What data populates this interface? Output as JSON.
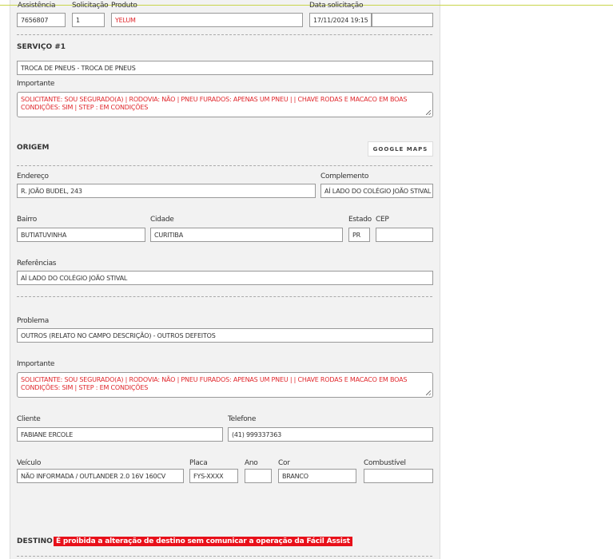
{
  "header": {
    "assistencia_label": "Assistência",
    "assistencia": "7656807",
    "solicitacao_label": "Solicitação",
    "solicitacao": "1",
    "produto_label": "Produto",
    "produto": "YELUM",
    "data_label": "Data solicitação",
    "data": "17/11/2024 19:15",
    "data_extra": ""
  },
  "servico": {
    "title": "SERVIÇO #1",
    "tipo": "TROCA DE PNEUS - TROCA DE PNEUS",
    "importante_label": "Importante",
    "importante": "SOLICITANTE: SOU SEGURADO(A) | RODOVIA: NÃO | PNEU FURADOS: APENAS UM PNEU |   | CHAVE RODAS E MACACO EM BOAS CONDIÇÕES: SIM | STEP : EM CONDIÇÕES"
  },
  "origem": {
    "title": "ORIGEM",
    "maps_button": "GOOGLE MAPS",
    "endereco_label": "Endereço",
    "endereco": "R. JOÃO BUDEL, 243",
    "complemento_label": "Complemento",
    "complemento": "AÍ LADO DO COLÉGIO JOÃO STIVAL",
    "bairro_label": "Bairro",
    "bairro": "BUTIATUVINHA",
    "cidade_label": "Cidade",
    "cidade": "CURITIBA",
    "estado_label": "Estado",
    "estado": "PR",
    "cep_label": "CEP",
    "cep": "",
    "referencias_label": "Referências",
    "referencias": "AÍ LADO DO COLÉGIO JOÃO STIVAL"
  },
  "problema": {
    "label": "Problema",
    "value": "OUTROS (RELATO NO CAMPO DESCRIÇÃO) - OUTROS DEFEITOS",
    "importante_label": "Importante",
    "importante": "SOLICITANTE: SOU SEGURADO(A) | RODOVIA: NÃO | PNEU FURADOS: APENAS UM PNEU |   | CHAVE RODAS E MACACO EM BOAS CONDIÇÕES: SIM | STEP : EM CONDIÇÕES"
  },
  "cliente": {
    "cliente_label": "Cliente",
    "cliente": "FABIANE ERCOLE",
    "telefone_label": "Telefone",
    "telefone": "(41) 999337363"
  },
  "veiculo": {
    "veiculo_label": "Veículo",
    "veiculo": "NÃO INFORMADA / OUTLANDER 2.0 16V 160CV",
    "placa_label": "Placa",
    "placa": "FYS-XXXX",
    "ano_label": "Ano",
    "ano": "",
    "cor_label": "Cor",
    "cor": "BRANCO",
    "combustivel_label": "Combustível",
    "combustivel": ""
  },
  "destino": {
    "title": "DESTINO",
    "warning": "É proibida a alteração de destino sem comunicar a operação da Fácil Assist"
  },
  "colors": {
    "accent_red": "#e0262b",
    "warning_bg": "#e8101a",
    "panel_bg": "#f2f2f2"
  }
}
